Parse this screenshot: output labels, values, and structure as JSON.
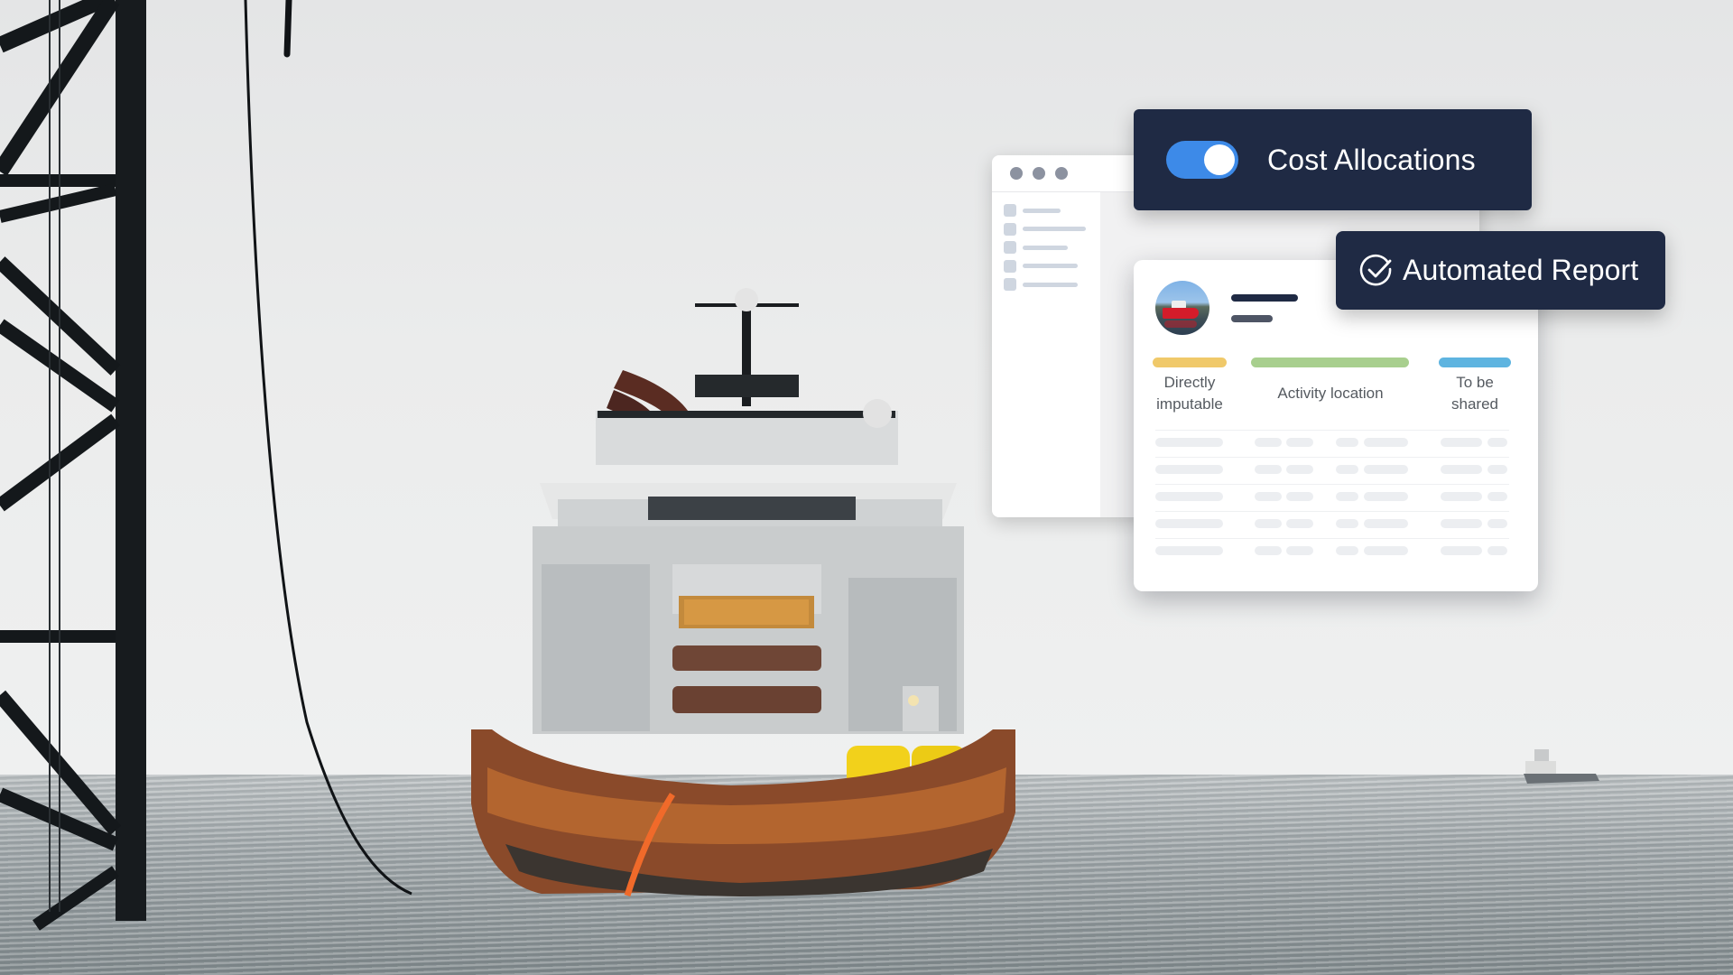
{
  "background": {
    "scene": "offshore-vessel-photo",
    "colors": {
      "sky": "#ebecec",
      "sea": "#9da4a7",
      "hull_rust": "#b05a28",
      "buoy_yellow": "#f2d11b",
      "hose_orange": "#f06a2a"
    }
  },
  "cost_allocations": {
    "label": "Cost Allocations",
    "toggle_on": true,
    "toggle_color": "#3d8ae8",
    "card_color": "#1f2a44"
  },
  "automated_report": {
    "label": "Automated Report",
    "icon": "check-circle-icon"
  },
  "back_window": {
    "window_controls": [
      "dot",
      "dot",
      "dot"
    ],
    "sidebar_items": 5
  },
  "report_card": {
    "avatar": "vessel-avatar",
    "categories": [
      {
        "label": "Directly imputable",
        "line1": "Directly",
        "line2": "imputable",
        "color": "#f0c96a"
      },
      {
        "label": "Activity location",
        "line1": "Activity location",
        "line2": "",
        "color": "#a8cf8e"
      },
      {
        "label": "To be shared",
        "line1": "To be",
        "line2": "shared",
        "color": "#5eb4e0"
      }
    ],
    "skeleton_rows": 5
  }
}
